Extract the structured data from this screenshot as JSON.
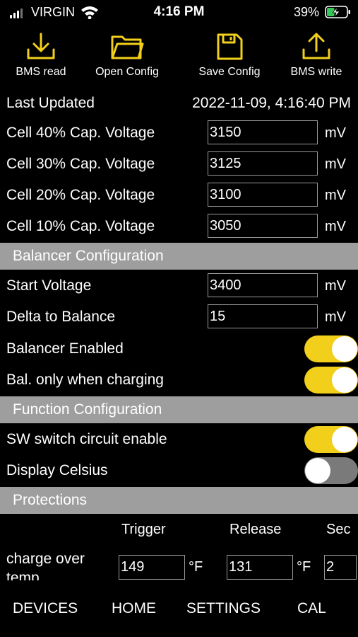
{
  "status_bar": {
    "carrier": "VIRGIN",
    "time": "4:16 PM",
    "battery_percent": "39%",
    "battery_level": 0.39,
    "charging": true
  },
  "toolbar": {
    "accent_color": "#f2cf1a",
    "items": [
      {
        "label": "BMS read",
        "icon": "download-icon"
      },
      {
        "label": "Open Config",
        "icon": "folder-icon"
      },
      {
        "label": "Save Config",
        "icon": "save-icon"
      },
      {
        "label": "BMS write",
        "icon": "upload-icon"
      }
    ]
  },
  "last_updated": {
    "label": "Last Updated",
    "value": "2022-11-09, 4:16:40 PM"
  },
  "capacity_voltages": [
    {
      "label": "Cell 40% Cap. Voltage",
      "value": "3150",
      "unit": "mV"
    },
    {
      "label": "Cell 30% Cap. Voltage",
      "value": "3125",
      "unit": "mV"
    },
    {
      "label": "Cell 20% Cap. Voltage",
      "value": "3100",
      "unit": "mV"
    },
    {
      "label": "Cell 10% Cap. Voltage",
      "value": "3050",
      "unit": "mV"
    }
  ],
  "balancer": {
    "title": "Balancer Configuration",
    "start_voltage": {
      "label": "Start Voltage",
      "value": "3400",
      "unit": "mV"
    },
    "delta": {
      "label": "Delta to Balance",
      "value": "15",
      "unit": "mV"
    },
    "enabled": {
      "label": "Balancer Enabled",
      "on": true
    },
    "charging_only": {
      "label": "Bal. only when charging",
      "on": true
    }
  },
  "function": {
    "title": "Function Configuration",
    "sw_switch": {
      "label": "SW switch circuit enable",
      "on": true
    },
    "celsius": {
      "label": "Display Celsius",
      "on": false
    }
  },
  "protections": {
    "title": "Protections",
    "columns": {
      "trigger": "Trigger",
      "release": "Release",
      "sec": "Sec"
    },
    "rows": [
      {
        "label": "charge over temp",
        "trigger": "149",
        "trigger_unit": "°F",
        "release": "131",
        "release_unit": "°F",
        "sec": "2"
      }
    ]
  },
  "bottom_nav": [
    "DEVICES",
    "HOME",
    "SETTINGS",
    "CAL"
  ],
  "colors": {
    "toggle_on": "#f2cf1a",
    "toggle_off": "#7a7a7a",
    "section_bg": "#9e9e9e"
  }
}
